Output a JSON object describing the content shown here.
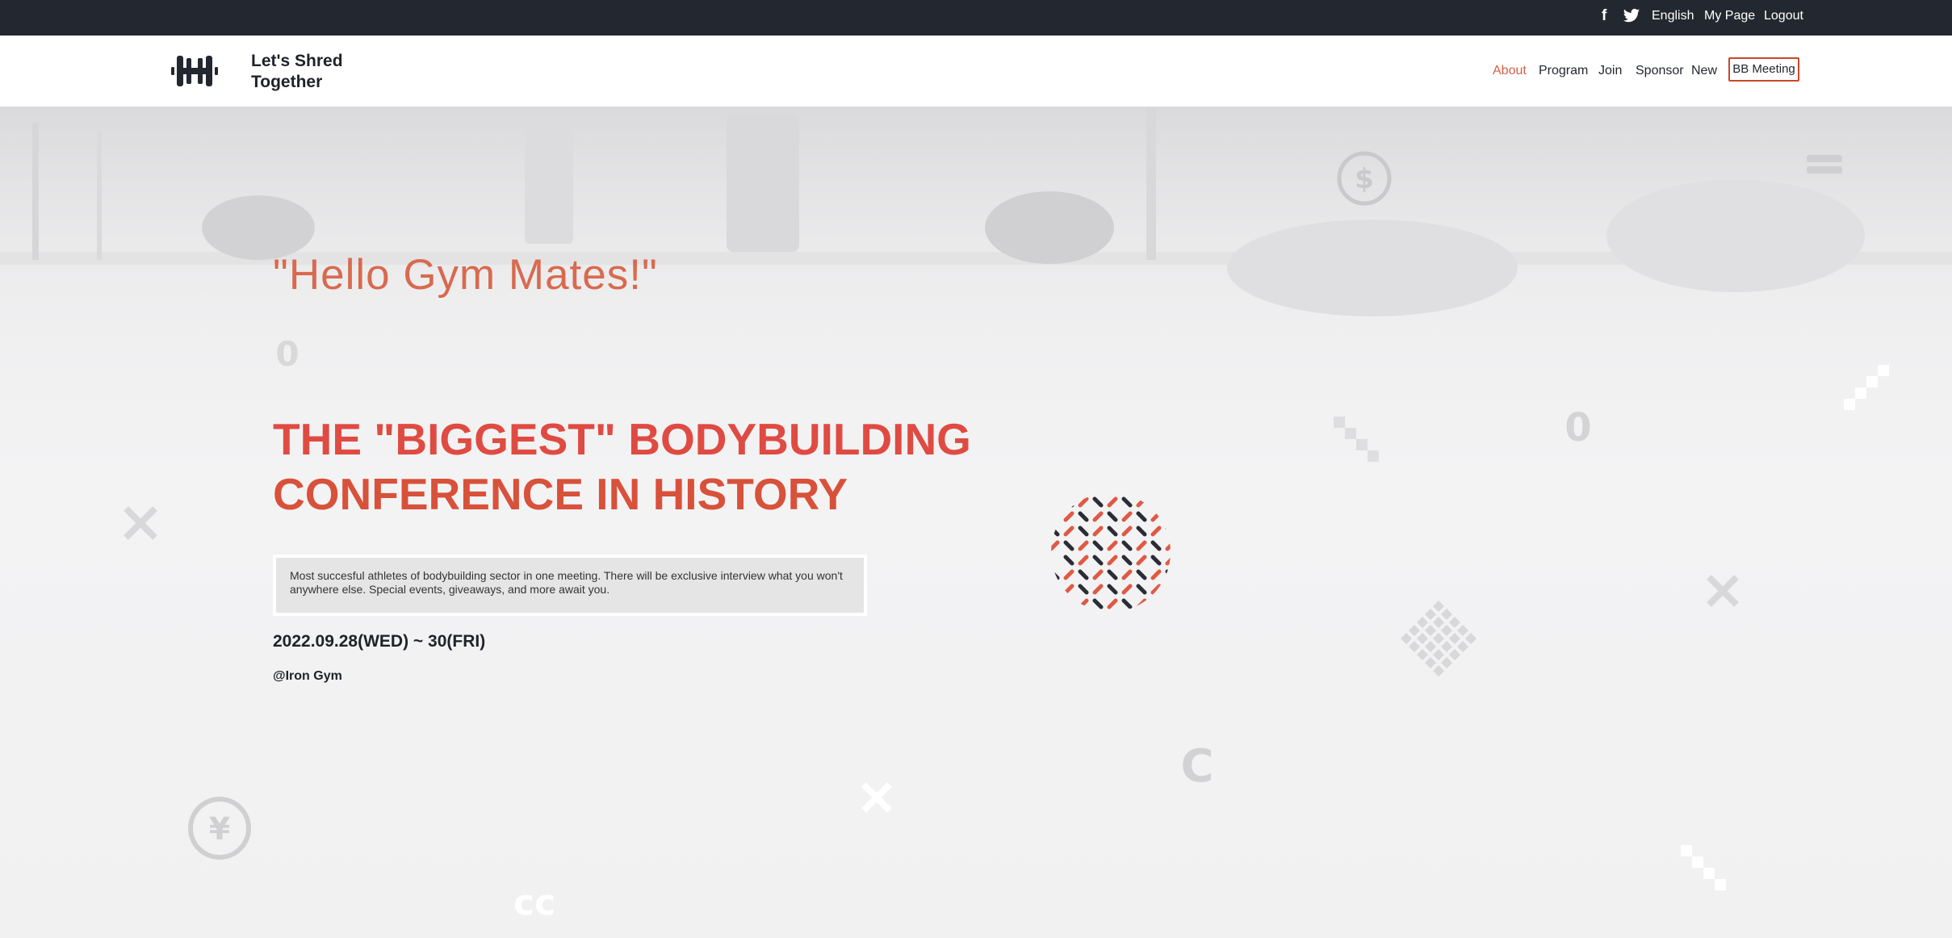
{
  "topbar": {
    "facebook_icon": "facebook-icon",
    "twitter_icon": "twitter-icon",
    "links": [
      "English",
      "My Page",
      "Logout"
    ]
  },
  "header": {
    "brand": "Let's Shred Together",
    "logo_icon": "barbell-icon",
    "nav": [
      "About",
      "Program",
      "Join",
      "Sponsor",
      "New"
    ],
    "active_nav": "About",
    "cta": "BB Meeting"
  },
  "hero": {
    "greeting": "\"Hello Gym Mates!\"",
    "headline_line1": "THE \"BIGGEST\" BODYBUILDING",
    "headline_line2": "CONFERENCE IN HISTORY",
    "description": "Most succesful athletes of bodybuilding sector in one meeting. There will be exclusive interview what you won't anywhere else. Special events, giveaways, and more await you.",
    "date": "2022.09.28(WED) ~ 30(FRI)",
    "venue": "@Iron Gym"
  },
  "colors": {
    "topbar": "#232730",
    "accent": "#d65f45",
    "headline": "#df4b42",
    "greeting": "#d86a4f",
    "text_dark": "#1f2229"
  }
}
